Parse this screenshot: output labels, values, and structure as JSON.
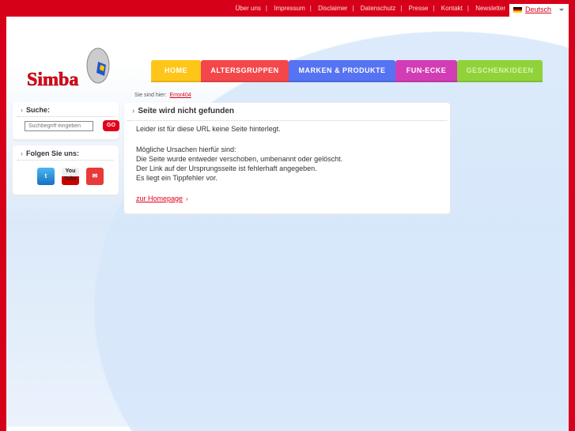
{
  "top_links": [
    "Über uns",
    "Impressum",
    "Disclaimer",
    "Datenschutz",
    "Presse",
    "Kontakt",
    "Newsletter"
  ],
  "language": "Deutsch",
  "logo": "Simba",
  "nav": [
    {
      "label": "HOME",
      "color": "#ffc61a"
    },
    {
      "label": "ALTERSGRUPPEN",
      "color": "#f4474b"
    },
    {
      "label": "MARKEN & PRODUKTE",
      "color": "#5573f2"
    },
    {
      "label": "FUN-ECKE",
      "color": "#d23db5"
    },
    {
      "label": "GESCHENKIDEEN",
      "color": "#8fd23a"
    }
  ],
  "breadcrumb": {
    "label": "Sie sind hier:",
    "current": "Error404"
  },
  "search": {
    "title": "Suche:",
    "placeholder": "Suchbegriff eingeben",
    "button": "GO"
  },
  "social": {
    "title": "Folgen Sie uns:",
    "items": [
      "twitter",
      "You Tube",
      "email"
    ]
  },
  "main": {
    "title": "Seite wird nicht gefunden",
    "intro": "Leider ist für diese URL keine Seite hinterlegt.",
    "reasons_title": "Mögliche Ursachen hierfür sind:",
    "reasons": [
      "Die Seite wurde entweder verschoben, umbenannt oder gelöscht.",
      "Der Link auf der Ursprungsseite ist fehlerhaft angegeben.",
      "Es liegt ein Tippfehler vor."
    ],
    "link": "zur Homepage"
  }
}
